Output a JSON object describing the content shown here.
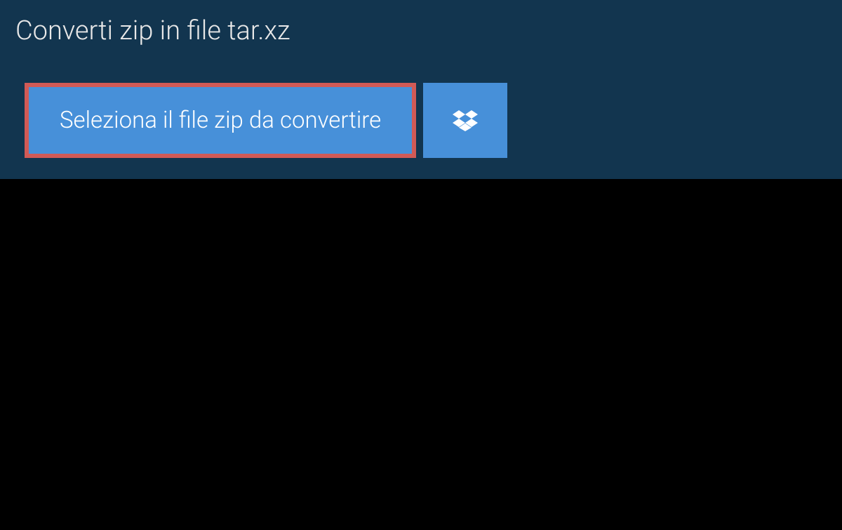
{
  "header": {
    "title": "Converti zip in file tar.xz"
  },
  "buttons": {
    "select_file_label": "Seleziona il file zip da convertire"
  },
  "colors": {
    "panel_background": "#12354f",
    "button_background": "#4790d9",
    "highlight_border": "#d15a56"
  }
}
